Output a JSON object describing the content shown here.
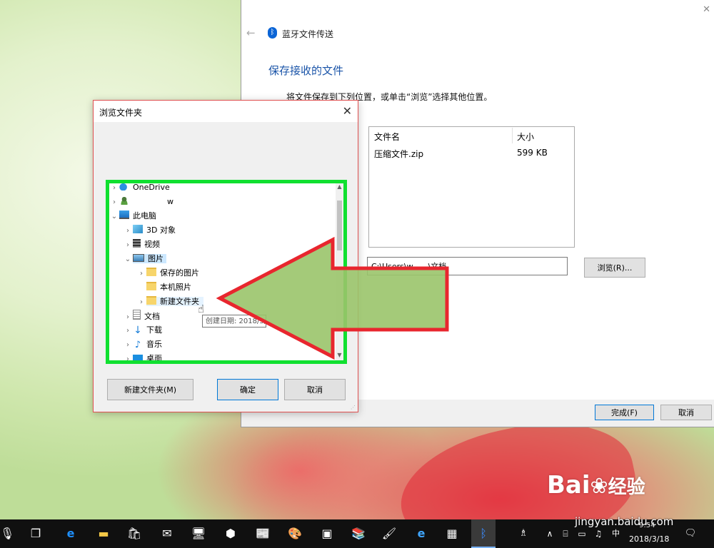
{
  "main_window": {
    "title": "蓝牙文件传送",
    "heading": "保存接收的文件",
    "instruction": "将文件保存到下列位置，或单击“浏览”选择其他位置。",
    "file_list": {
      "columns": [
        "文件名",
        "大小"
      ],
      "rows": [
        {
          "name": "压缩文件.zip",
          "size": "599 KB"
        }
      ]
    },
    "location_value": "C:\\Users\\w      \\文档",
    "browse_label": "浏览(R)...",
    "finish_label": "完成(F)",
    "cancel_label": "取消"
  },
  "browse_dialog": {
    "title": "浏览文件夹",
    "tree": [
      {
        "label": "OneDrive",
        "icon": "cloud-icon"
      },
      {
        "label": "w",
        "icon": "user-icon"
      },
      {
        "label": "此电脑",
        "icon": "computer-icon"
      },
      {
        "label": "3D 对象",
        "icon": "cube-icon"
      },
      {
        "label": "视频",
        "icon": "video-icon"
      },
      {
        "label": "图片",
        "icon": "pictures-icon"
      },
      {
        "label": "保存的图片",
        "icon": "folder-icon"
      },
      {
        "label": "本机照片",
        "icon": "folder-icon"
      },
      {
        "label": "新建文件夹",
        "icon": "folder-icon"
      },
      {
        "label": "文档",
        "icon": "document-icon"
      },
      {
        "label": "下载",
        "icon": "download-icon"
      },
      {
        "label": "音乐",
        "icon": "music-icon"
      },
      {
        "label": "桌面",
        "icon": "desktop-icon"
      }
    ],
    "tooltip": "创建日期: 2018/3/",
    "new_folder_label": "新建文件夹(M)",
    "ok_label": "确定",
    "cancel_label": "取消"
  },
  "watermark": {
    "logo": "Bai",
    "logo_suffix": "经验",
    "url": "jingyan.baidu.com"
  },
  "taskbar": {
    "time": "9:54",
    "date": "2018/3/18",
    "ime": "中",
    "colors": {
      "accent": "#0078d7",
      "arrow_fill": "#9ac46a",
      "arrow_stroke": "#e8262e",
      "highlight": "#10e030"
    }
  }
}
